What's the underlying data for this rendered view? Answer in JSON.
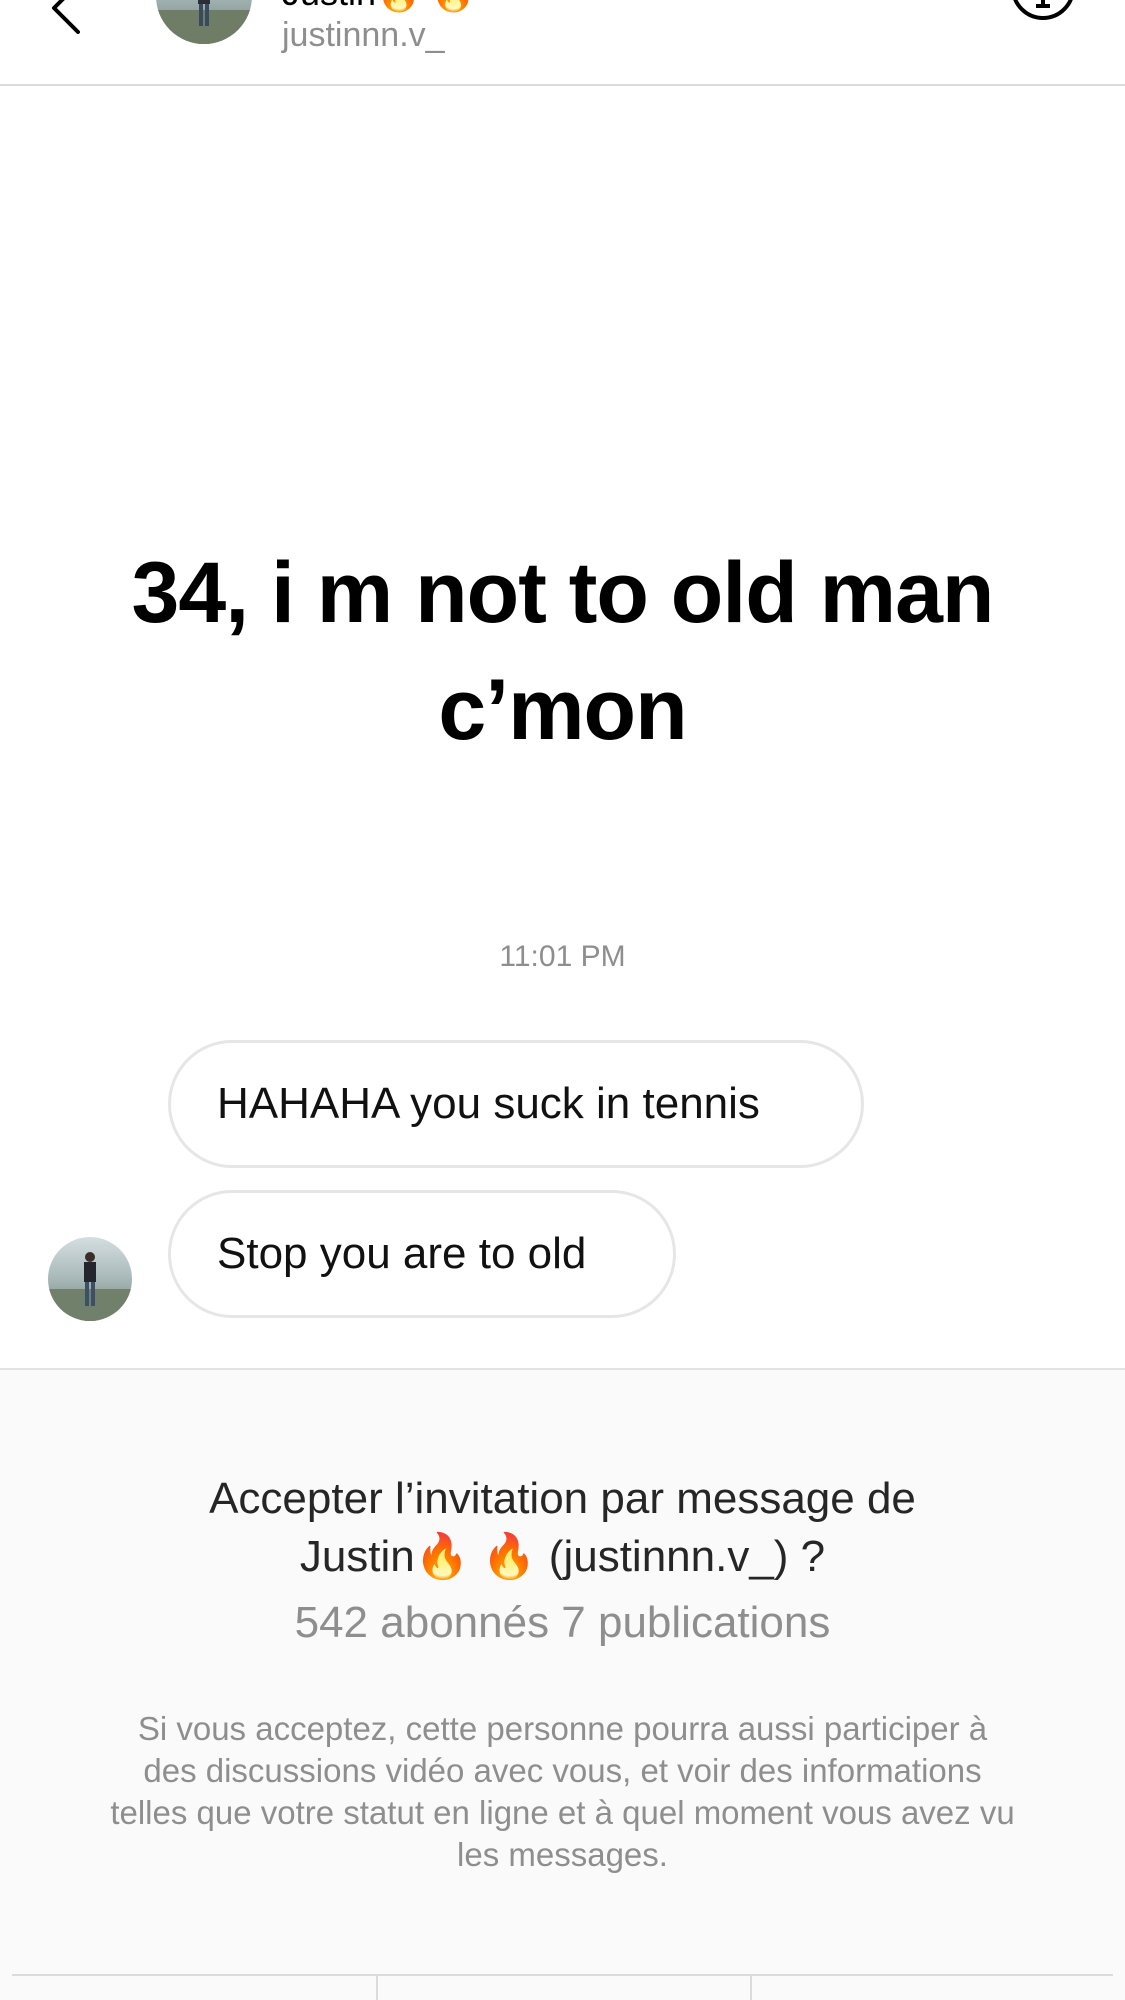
{
  "header": {
    "display_name": "Justin🔥 🔥",
    "username": "justinnn.v_",
    "back_icon": "chevron-left-icon",
    "info_icon": "info-icon"
  },
  "story": {
    "text": "34, i m not to old man c’mon"
  },
  "conversation": {
    "timestamp": "11:01 PM",
    "messages": [
      {
        "text": "HAHAHA you suck in tennis"
      },
      {
        "text": "Stop you are to old"
      }
    ]
  },
  "invite": {
    "title_line1": "Accepter l’invitation par message de",
    "title_line2": "Justin🔥 🔥  (justinnn.v_) ?",
    "stats": "542 abonnés 7 publications",
    "description": "Si vous acceptez, cette personne pourra aussi participer à des discussions vidéo avec vous, et voir des informations telles que votre statut en ligne et à quel moment vous avez vu les messages."
  },
  "colors": {
    "secondary_text": "#8e8e8e",
    "bubble_border": "#e6e6e6",
    "panel_background": "#fafafa",
    "divider": "#dbdbdb"
  }
}
